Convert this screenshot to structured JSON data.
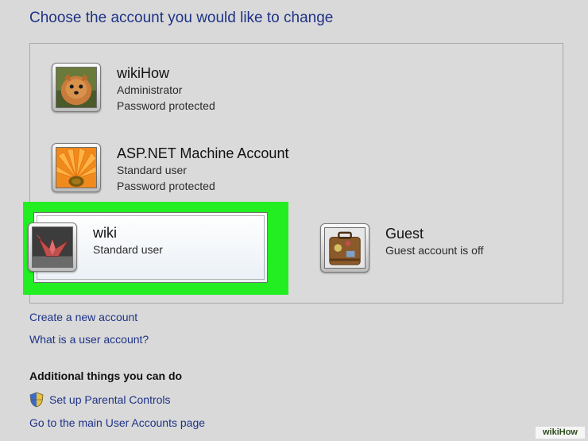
{
  "page": {
    "title": "Choose the account you would like to change"
  },
  "accounts": [
    {
      "name": "wikiHow",
      "lines": [
        "Administrator",
        "Password protected"
      ],
      "picture": "dog-picture"
    },
    {
      "name": "ASP.NET Machine Account",
      "lines": [
        "Standard user",
        "Password protected"
      ],
      "picture": "flower-picture"
    },
    {
      "name": "wiki",
      "lines": [
        "Standard user"
      ],
      "picture": "paper-crane-picture",
      "selected": true
    },
    {
      "name": "Guest",
      "lines": [
        "Guest account is off"
      ],
      "picture": "suitcase-picture"
    }
  ],
  "links": {
    "create": "Create a new account",
    "what_is": "What is a user account?"
  },
  "additional": {
    "heading": "Additional things you can do",
    "parental": "Set up Parental Controls",
    "main_page": "Go to the main User Accounts page"
  },
  "watermark": "wikiHow",
  "colors": {
    "link": "#1e3287",
    "highlight": "#22ee22"
  }
}
